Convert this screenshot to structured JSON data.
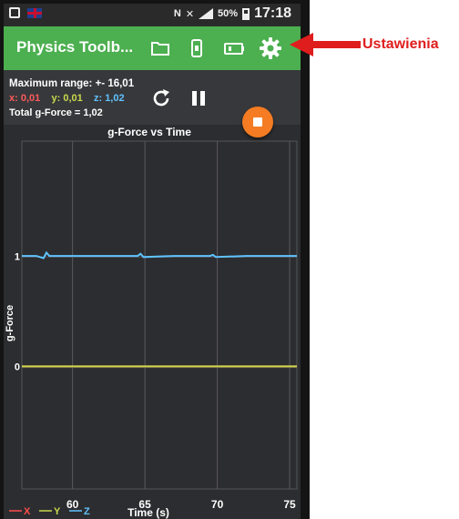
{
  "status_bar": {
    "battery_percent": "50%",
    "time": "17:18"
  },
  "toolbar": {
    "title": "Physics Toolb...",
    "icons": [
      "folder-icon",
      "phone-icon",
      "battery-icon",
      "gear-icon"
    ],
    "color": "#4caf50"
  },
  "info": {
    "max_range": "Maximum range: +- 16,01",
    "x_label": "x: 0,01",
    "y_label": "y: 0,01",
    "z_label": "z: 1,02",
    "total": "Total g-Force = 1,02",
    "x_color": "#ff5a5a",
    "y_color": "#c8d84c",
    "z_color": "#5fc3ff"
  },
  "controls": {
    "reset_icon": "refresh-icon",
    "pause_icon": "pause-icon",
    "stop_icon": "stop-icon",
    "stop_color": "#f57c22"
  },
  "annotation": {
    "label": "Ustawienia",
    "color": "#e01d1d"
  },
  "chart_data": {
    "type": "line",
    "title": "g-Force vs Time",
    "xlabel": "Time (s)",
    "ylabel": "g-Force",
    "xlim": [
      56.5,
      75.5
    ],
    "ylim": [
      -1.1,
      2.05
    ],
    "x_ticks": [
      60,
      65,
      70,
      75
    ],
    "y_ticks": [
      {
        "value": 1,
        "label": "1"
      },
      {
        "value": 0,
        "label": "0"
      }
    ],
    "grid": true,
    "legend": "bottom-left",
    "series": [
      {
        "name": "X",
        "color": "#ff4d4d",
        "x": [
          56.5,
          60,
          65,
          70,
          75,
          75.5
        ],
        "y": [
          0.01,
          0.01,
          0.01,
          0.01,
          0.01,
          0.01
        ]
      },
      {
        "name": "Y",
        "color": "#c8d84c",
        "x": [
          56.5,
          60,
          65,
          70,
          75,
          75.5
        ],
        "y": [
          0.01,
          0.01,
          0.01,
          0.01,
          0.01,
          0.01
        ]
      },
      {
        "name": "Z",
        "color": "#5fc3ff",
        "x": [
          56.5,
          57.5,
          58.0,
          58.2,
          58.4,
          60,
          62,
          64.5,
          64.7,
          64.9,
          67,
          69.5,
          69.7,
          69.9,
          72,
          75.5
        ],
        "y": [
          1.01,
          1.01,
          0.99,
          1.04,
          1.01,
          1.01,
          1.01,
          1.01,
          1.03,
          1.0,
          1.01,
          1.01,
          1.02,
          1.0,
          1.01,
          1.01
        ]
      }
    ]
  }
}
